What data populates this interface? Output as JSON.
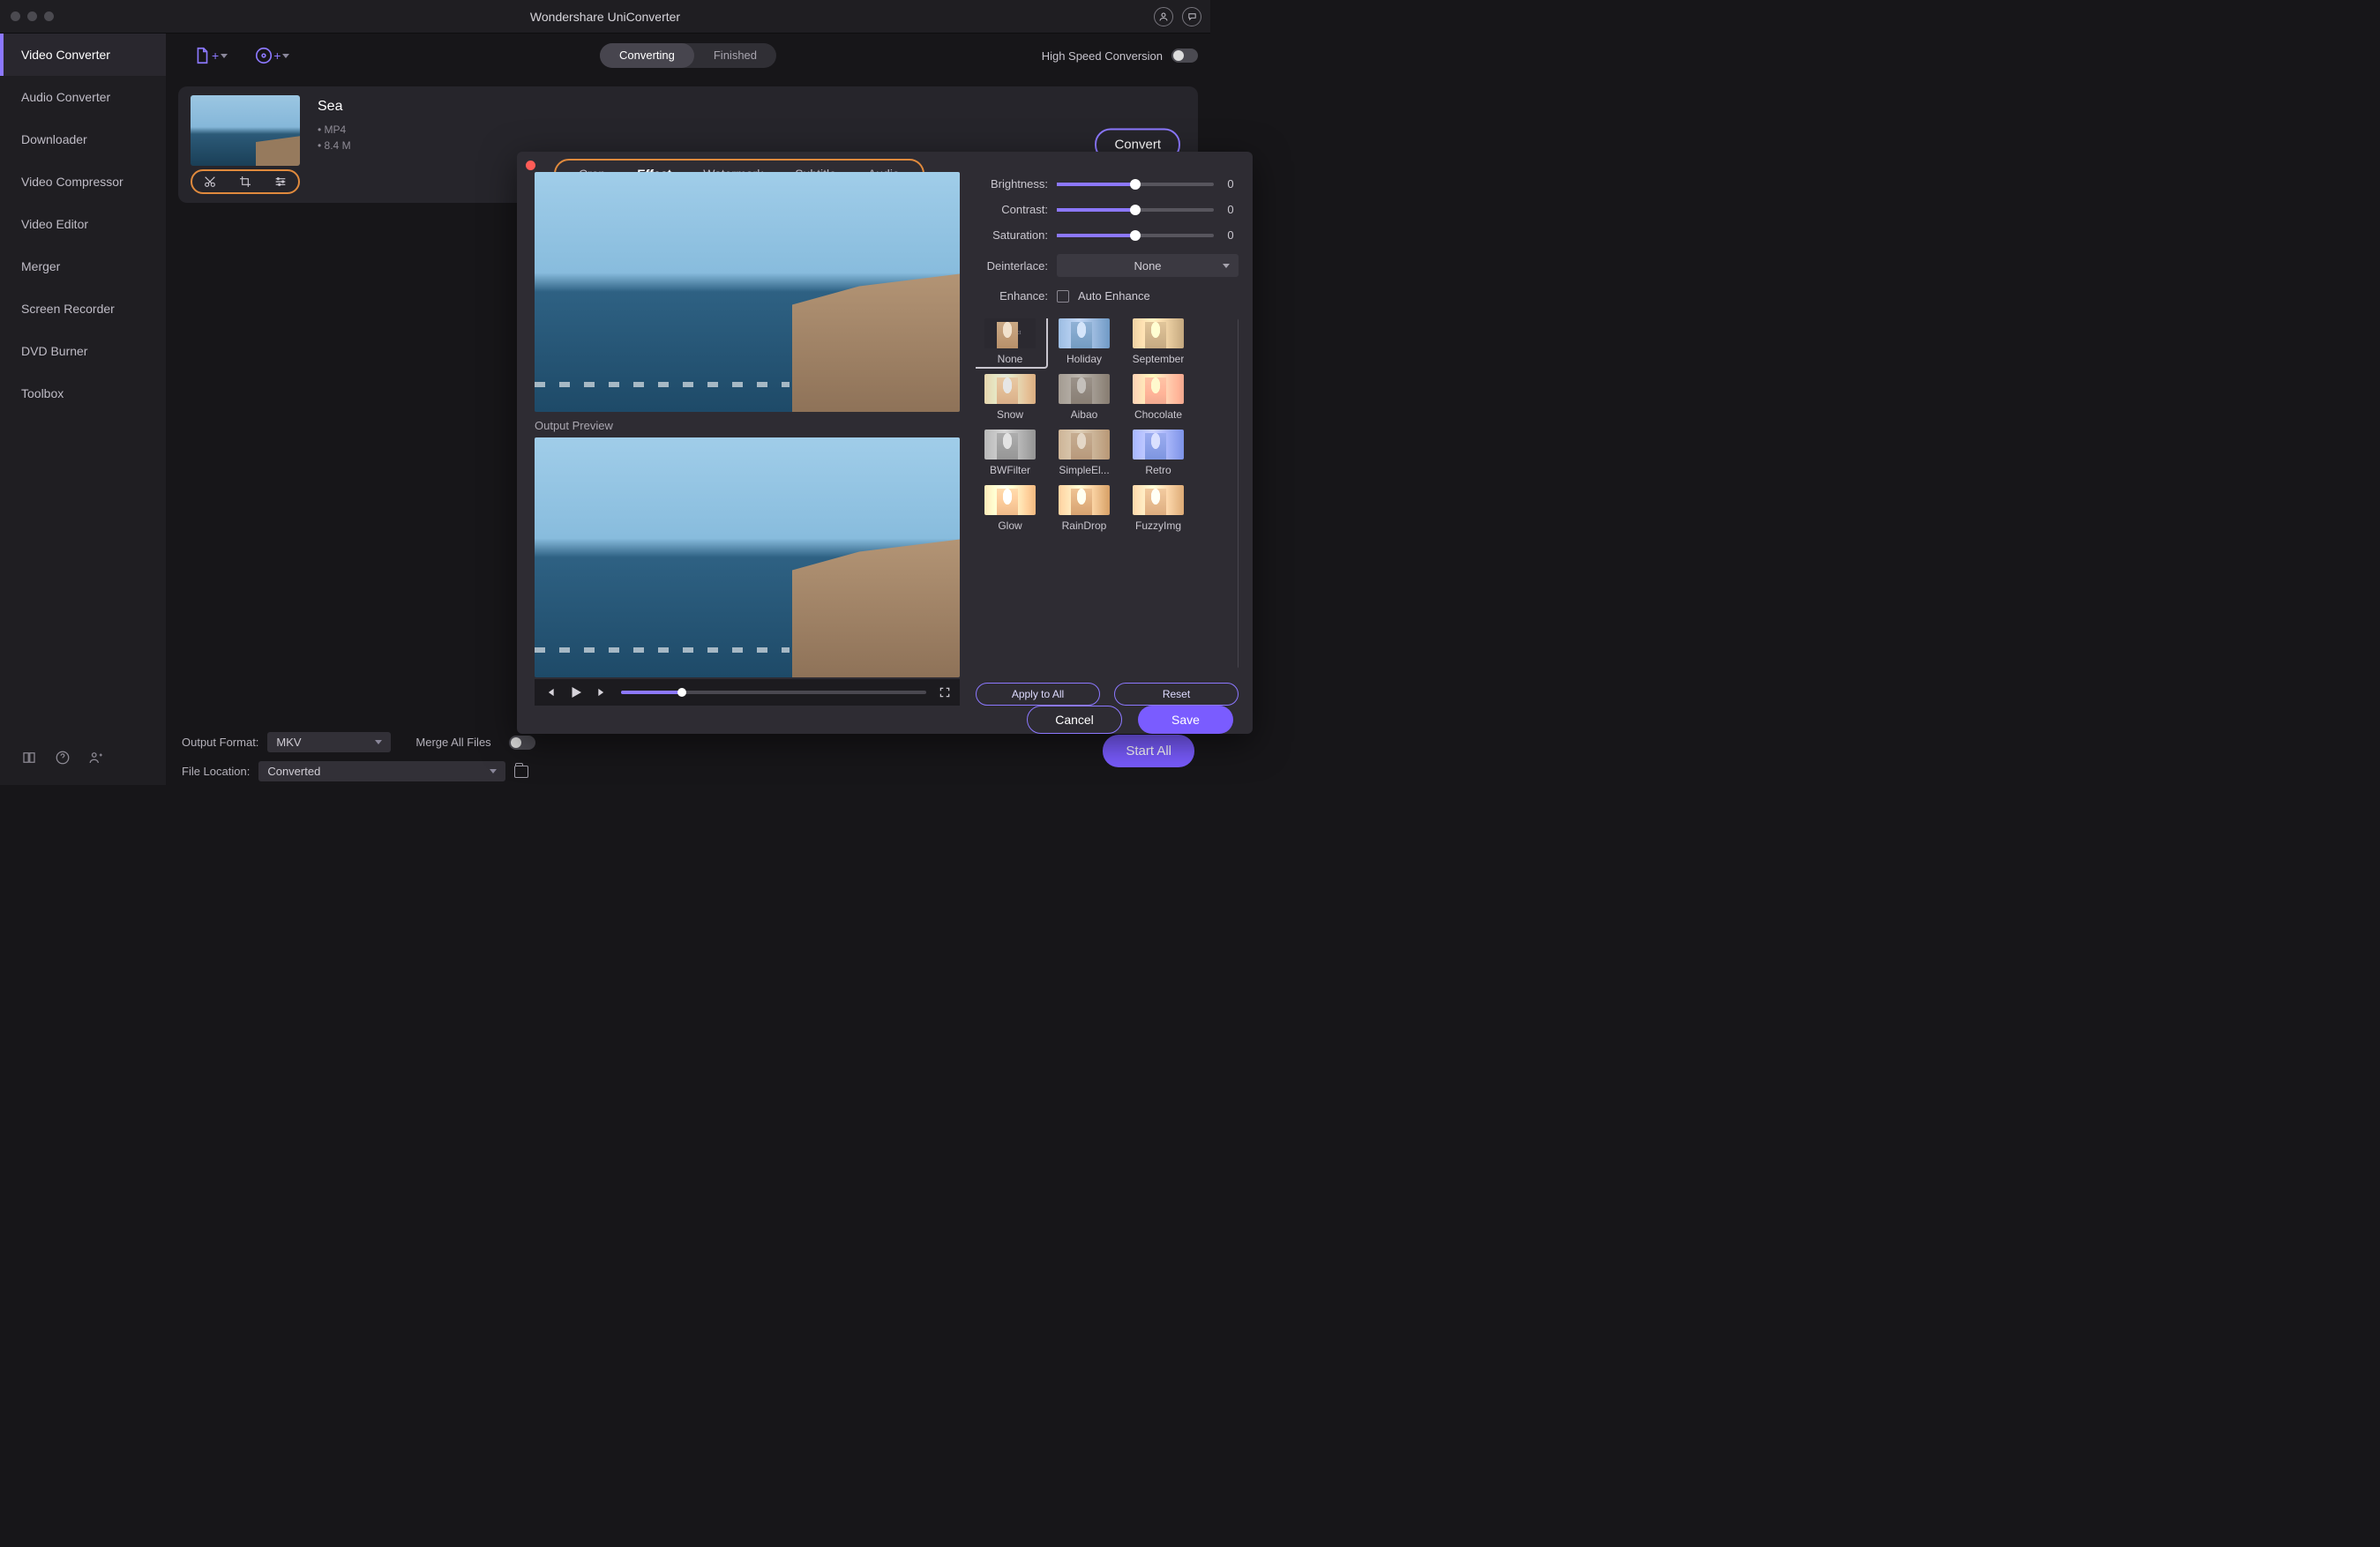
{
  "app_title": "Wondershare UniConverter",
  "sidebar": {
    "items": [
      "Video Converter",
      "Audio Converter",
      "Downloader",
      "Video Compressor",
      "Video Editor",
      "Merger",
      "Screen Recorder",
      "DVD Burner",
      "Toolbox"
    ]
  },
  "toolbar": {
    "segments": {
      "converting": "Converting",
      "finished": "Finished"
    },
    "hispeed": "High Speed Conversion"
  },
  "file": {
    "title": "Sea",
    "format": "MP4",
    "size": "8.4 M"
  },
  "convert": "Convert",
  "editor": {
    "tabs": {
      "crop": "Crop",
      "effect": "Effect",
      "watermark": "Watermark",
      "subtitle": "Subtitle",
      "audio": "Audio"
    },
    "output_preview": "Output Preview",
    "sliders": {
      "brightness": {
        "label": "Brightness:",
        "value": "0"
      },
      "contrast": {
        "label": "Contrast:",
        "value": "0"
      },
      "saturation": {
        "label": "Saturation:",
        "value": "0"
      }
    },
    "deinterlace": {
      "label": "Deinterlace:",
      "value": "None"
    },
    "enhance": {
      "label": "Enhance:",
      "option": "Auto Enhance"
    },
    "effects": [
      "None",
      "Holiday",
      "September",
      "Snow",
      "Aibao",
      "Chocolate",
      "BWFilter",
      "SimpleEl...",
      "Retro",
      "Glow",
      "RainDrop",
      "FuzzyImg"
    ],
    "apply_all": "Apply to All",
    "reset": "Reset",
    "cancel": "Cancel",
    "save": "Save"
  },
  "bottom": {
    "output_format_label": "Output Format:",
    "output_format": "MKV",
    "file_location_label": "File Location:",
    "file_location": "Converted",
    "merge": "Merge All Files",
    "start": "Start All"
  }
}
